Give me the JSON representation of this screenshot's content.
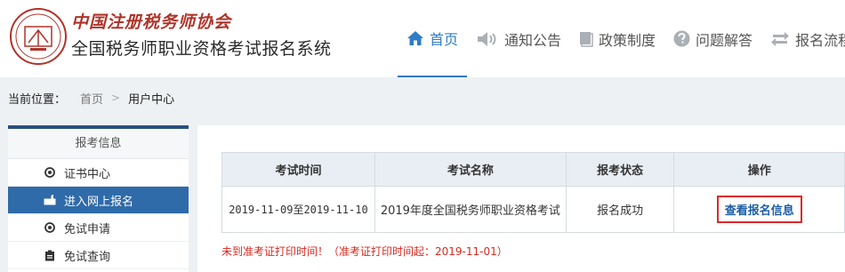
{
  "header": {
    "org_name": "中国注册税务师协会",
    "system_name": "全国税务师职业资格考试报名系统"
  },
  "nav": [
    {
      "label": "首页",
      "icon": "home-icon",
      "active": true
    },
    {
      "label": "通知公告",
      "icon": "megaphone-icon",
      "active": false
    },
    {
      "label": "政策制度",
      "icon": "book-icon",
      "active": false
    },
    {
      "label": "问题解答",
      "icon": "question-icon",
      "active": false
    },
    {
      "label": "报名流程",
      "icon": "refresh-icon",
      "active": false
    }
  ],
  "breadcrumb": {
    "label": "当前位置：",
    "home": "首页",
    "separator": ">",
    "current": "用户中心"
  },
  "sidebar": {
    "title": "报考信息",
    "items": [
      {
        "label": "证书中心",
        "icon": "circle-dot-icon",
        "active": false
      },
      {
        "label": "进入网上报名",
        "icon": "pointer-hand-icon",
        "active": true
      },
      {
        "label": "免试申请",
        "icon": "circle-dot-icon",
        "active": false
      },
      {
        "label": "免试查询",
        "icon": "clipboard-icon",
        "active": false
      }
    ]
  },
  "table": {
    "headers": [
      "考试时间",
      "考试名称",
      "报考状态",
      "操作"
    ],
    "rows": [
      {
        "time": "2019-11-09至2019-11-10",
        "name": "2019年度全国税务师职业资格考试",
        "status": "报名成功",
        "action": "查看报名信息"
      }
    ]
  },
  "notice": "未到准考证打印时间！（准考证打印时间起：2019-11-01）",
  "colors": {
    "brand_blue": "#2f7bc4",
    "sidebar_active": "#2f6aa9",
    "alert_red": "#d9281f",
    "logo_red": "#b0342a"
  }
}
